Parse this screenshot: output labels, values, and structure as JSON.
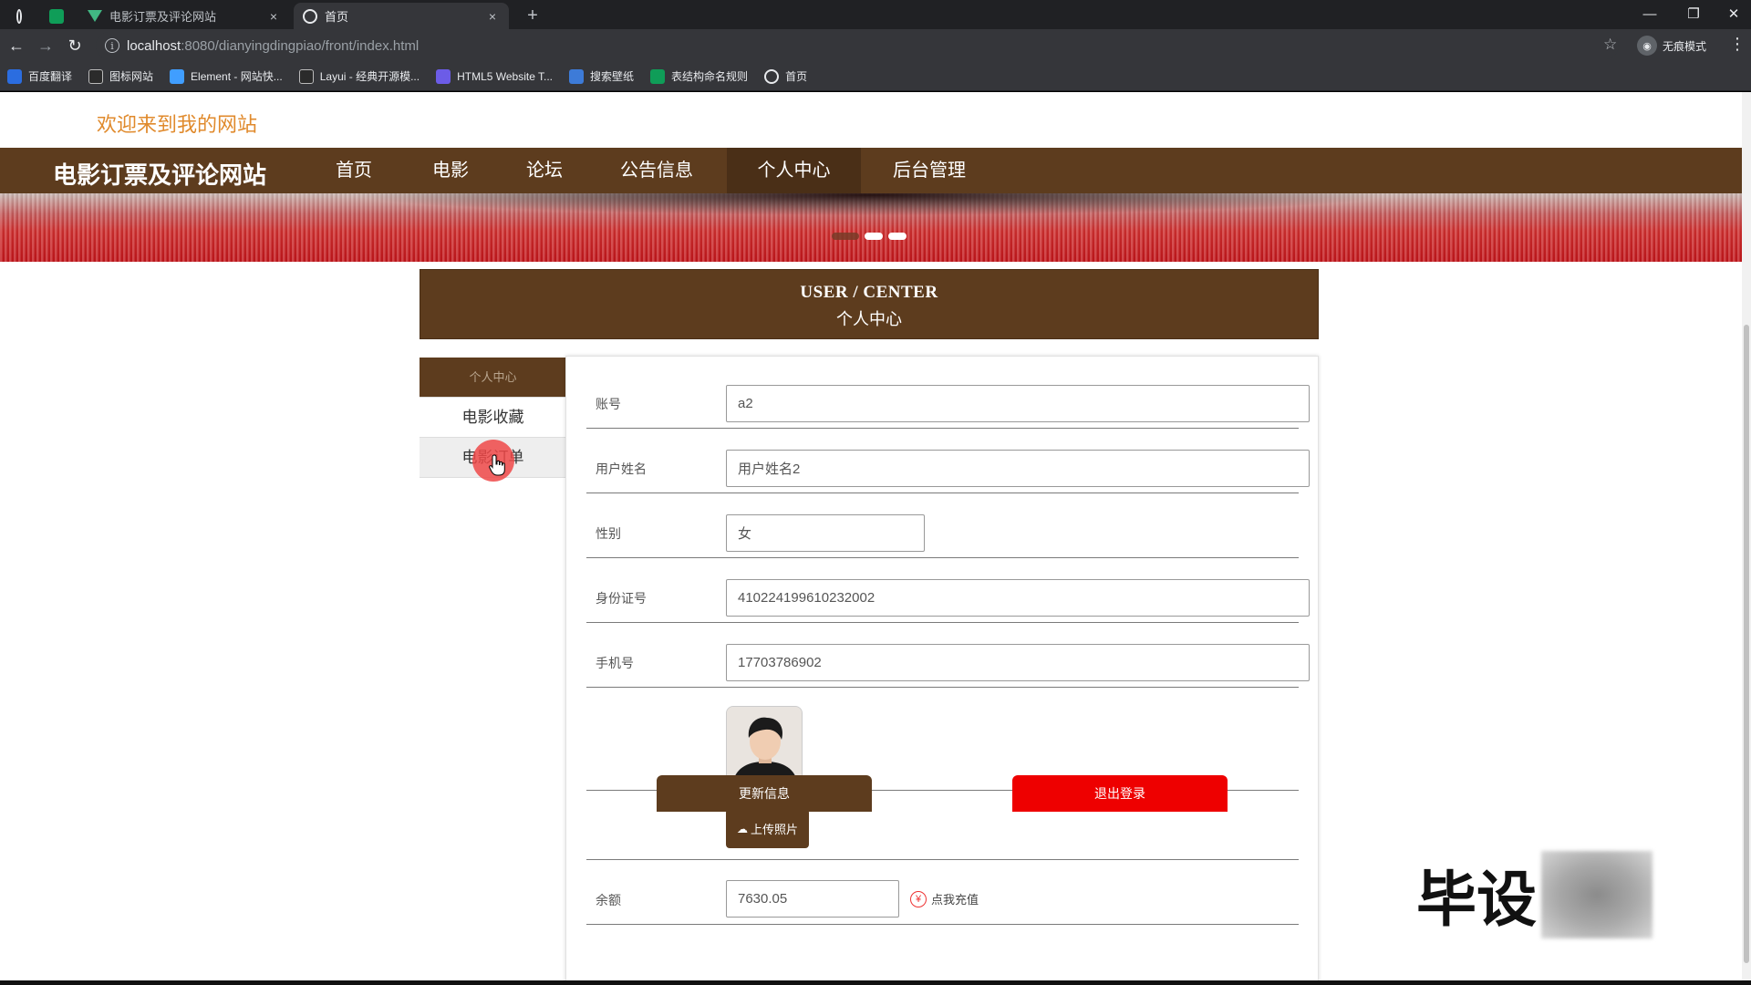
{
  "browser": {
    "tabs": [
      {
        "label": ""
      },
      {
        "label": ""
      },
      {
        "label": "电影订票及评论网站",
        "close": "×"
      },
      {
        "label": "首页",
        "close": "×"
      }
    ],
    "new_tab": "+",
    "window_controls": {
      "minimize": "—",
      "restore": "❐",
      "close": "✕"
    },
    "url_host": "localhost",
    "url_path": ":8080/dianyingdingpiao/front/index.html",
    "incognito_label": "无痕模式",
    "bookmarks": [
      {
        "label": "百度翻译",
        "color": "#2b6de0"
      },
      {
        "label": "图标网站",
        "color": "#2b2b2b"
      },
      {
        "label": "Element - 网站快...",
        "color": "#409eff"
      },
      {
        "label": "Layui - 经典开源模...",
        "color": "#2b2b2b"
      },
      {
        "label": "HTML5 Website T...",
        "color": "#6c5ce7"
      },
      {
        "label": "搜索壁纸",
        "color": "#3d7bd8"
      },
      {
        "label": "表结构命名规则",
        "color": "#0f9d58"
      },
      {
        "label": "首页",
        "color": "#e8eaed"
      }
    ]
  },
  "site": {
    "welcome": "欢迎来到我的网站",
    "title": "电影订票及评论网站",
    "nav": [
      "首页",
      "电影",
      "论坛",
      "公告信息",
      "个人中心",
      "后台管理"
    ],
    "active_nav": "个人中心",
    "carousel_dots": 3,
    "accent_color": "#5d3c1e",
    "danger_color": "#ee0000"
  },
  "center": {
    "title_en": "USER / CENTER",
    "title_cn": "个人中心",
    "side_menu": [
      "个人中心",
      "电影收藏",
      "电影订单"
    ]
  },
  "form": {
    "account_label": "账号",
    "account_value": "a2",
    "name_label": "用户姓名",
    "name_value": "用户姓名2",
    "gender_label": "性别",
    "gender_value": "女",
    "id_label": "身份证号",
    "id_value": "410224199610232002",
    "phone_label": "手机号",
    "phone_value": "17703786902",
    "upload_label": "上传照片",
    "balance_label": "余额",
    "balance_value": "7630.05",
    "recharge_label": "点我充值",
    "update_button": "更新信息",
    "logout_button": "退出登录"
  },
  "watermark": "毕设"
}
